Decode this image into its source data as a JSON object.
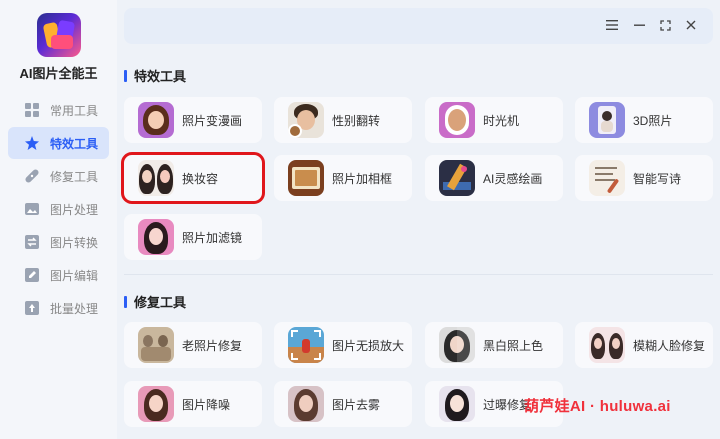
{
  "app": {
    "name": "AI图片全能王"
  },
  "sidebar": {
    "items": [
      {
        "label": "常用工具",
        "icon": "grid-icon",
        "active": false
      },
      {
        "label": "特效工具",
        "icon": "star-sparkle-icon",
        "active": true
      },
      {
        "label": "修复工具",
        "icon": "bandage-icon",
        "active": false
      },
      {
        "label": "图片处理",
        "icon": "image-edit-icon",
        "active": false
      },
      {
        "label": "图片转换",
        "icon": "convert-icon",
        "active": false
      },
      {
        "label": "图片编辑",
        "icon": "pencil-icon",
        "active": false
      },
      {
        "label": "批量处理",
        "icon": "batch-upload-icon",
        "active": false
      }
    ]
  },
  "window_controls": [
    "menu-icon",
    "minimize-icon",
    "maximize-icon",
    "close-icon"
  ],
  "sections": {
    "effects": {
      "title": "特效工具",
      "tools": [
        {
          "label": "照片变漫画",
          "icon": "cartoon-girl-icon"
        },
        {
          "label": "性别翻转",
          "icon": "gender-swap-icon"
        },
        {
          "label": "时光机",
          "icon": "time-machine-icon"
        },
        {
          "label": "3D照片",
          "icon": "3d-photo-icon"
        },
        {
          "label": "换妆容",
          "icon": "makeup-swap-icon",
          "highlighted": true
        },
        {
          "label": "照片加相框",
          "icon": "photo-frame-icon"
        },
        {
          "label": "AI灵感绘画",
          "icon": "ai-painting-icon"
        },
        {
          "label": "智能写诗",
          "icon": "poem-writing-icon"
        },
        {
          "label": "照片加滤镜",
          "icon": "photo-filter-icon"
        }
      ]
    },
    "repair": {
      "title": "修复工具",
      "tools": [
        {
          "label": "老照片修复",
          "icon": "old-photo-icon"
        },
        {
          "label": "图片无损放大",
          "icon": "lossless-enlarge-icon"
        },
        {
          "label": "黑白照上色",
          "icon": "colorize-icon"
        },
        {
          "label": "模糊人脸修复",
          "icon": "face-restore-icon"
        },
        {
          "label": "图片降噪",
          "icon": "denoise-icon"
        },
        {
          "label": "图片去雾",
          "icon": "dehaze-icon"
        },
        {
          "label": "过曝修复",
          "icon": "overexposure-icon"
        }
      ]
    }
  },
  "watermark": "葫芦娃AI · huluwa.ai",
  "colors": {
    "accent": "#2b5ef5",
    "highlight": "#e0161b",
    "watermark": "#f0313c"
  }
}
